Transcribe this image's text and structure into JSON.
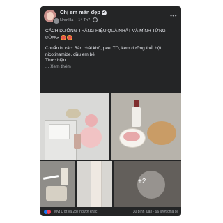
{
  "header": {
    "group_name": "Chị em mần đẹp",
    "author": "Như Hà",
    "dot": "·",
    "time": "14 Th7"
  },
  "post": {
    "title": "CÁCH DƯỠNG TRẮNG HIỆU QUẢ NHẤT VÀ MÌNH TỪNG DÙNG",
    "ingredients": "Chuẩn bị các: Bàn chải khô, peel TO, kem dưỡng thể, bột nicotinamide, dầu em bé",
    "steps": "Thực hiện",
    "see_more": "... Xem thêm"
  },
  "photos": {
    "more_count": "+2"
  },
  "footer": {
    "reactions": "Mỹt Ướt và 287 người khác",
    "comments": "30 bình luận",
    "shares": "96 lượt chia sẻ"
  },
  "icons": {
    "verified": "verified-badge-icon",
    "more": "more-options-icon",
    "globe": "globe-icon",
    "like": "like-reaction-icon",
    "love": "love-reaction-icon"
  },
  "colors": {
    "card_bg": "#242526",
    "text": "#e4e6eb",
    "secondary_text": "#b0b3b8",
    "like_blue": "#1877f2",
    "love_red": "#f33e58"
  }
}
